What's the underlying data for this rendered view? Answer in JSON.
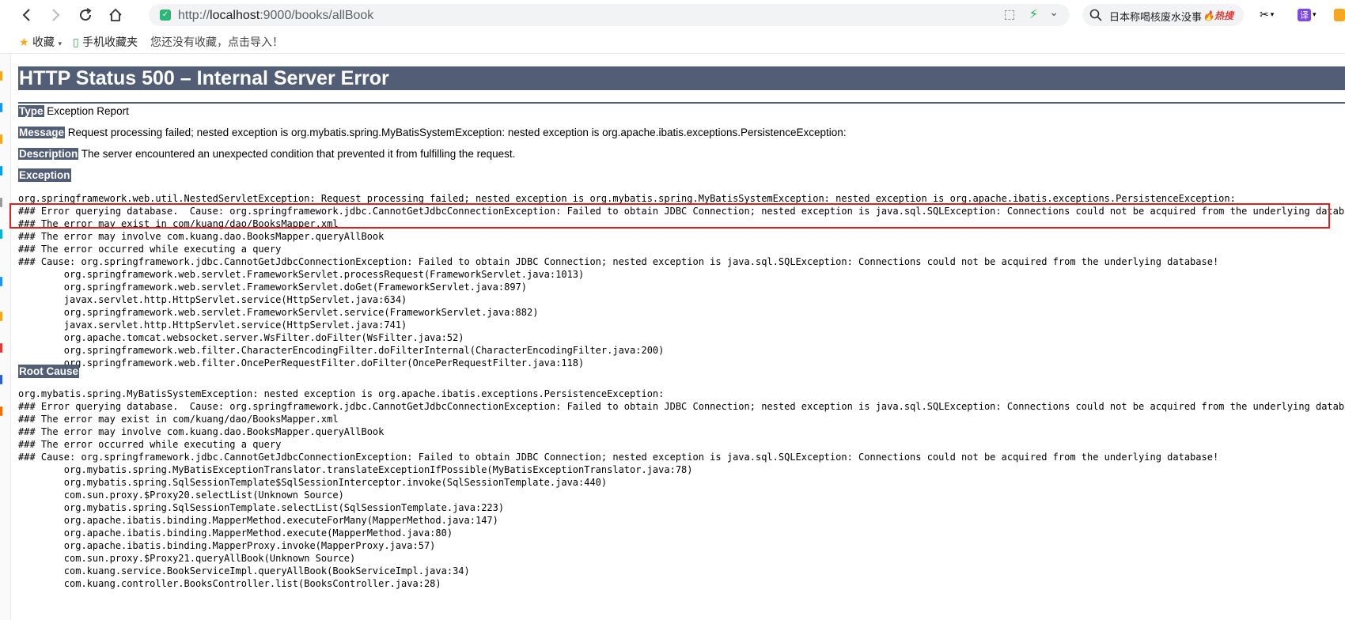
{
  "browser": {
    "url_scheme": "http://",
    "url_host": "localhost",
    "url_rest": ":9000/books/allBook",
    "search_query": "日本称喝核废水没事",
    "search_hot": "🔥热搜",
    "bookmarks": {
      "favorites": "收藏",
      "mobile": "手机收藏夹",
      "empty_hint": "您还没有收藏，点击导入！"
    },
    "translate_label": "译"
  },
  "page": {
    "title": "HTTP Status 500 – Internal Server Error",
    "type_label": "Type",
    "type_value": " Exception Report",
    "message_label": "Message",
    "message_value": " Request processing failed; nested exception is org.mybatis.spring.MyBatisSystemException: nested exception is org.apache.ibatis.exceptions.PersistenceException:",
    "description_label": "Description",
    "description_value": " The server encountered an unexpected condition that prevented it from fulfilling the request.",
    "exception_label": "Exception",
    "exception_trace": "org.springframework.web.util.NestedServletException: Request processing failed; nested exception is org.mybatis.spring.MyBatisSystemException: nested exception is org.apache.ibatis.exceptions.PersistenceException: \n### Error querying database.  Cause: org.springframework.jdbc.CannotGetJdbcConnectionException: Failed to obtain JDBC Connection; nested exception is java.sql.SQLException: Connections could not be acquired from the underlying database!\n### The error may exist in com/kuang/dao/BooksMapper.xml\n### The error may involve com.kuang.dao.BooksMapper.queryAllBook\n### The error occurred while executing a query\n### Cause: org.springframework.jdbc.CannotGetJdbcConnectionException: Failed to obtain JDBC Connection; nested exception is java.sql.SQLException: Connections could not be acquired from the underlying database!\n\torg.springframework.web.servlet.FrameworkServlet.processRequest(FrameworkServlet.java:1013)\n\torg.springframework.web.servlet.FrameworkServlet.doGet(FrameworkServlet.java:897)\n\tjavax.servlet.http.HttpServlet.service(HttpServlet.java:634)\n\torg.springframework.web.servlet.FrameworkServlet.service(FrameworkServlet.java:882)\n\tjavax.servlet.http.HttpServlet.service(HttpServlet.java:741)\n\torg.apache.tomcat.websocket.server.WsFilter.doFilter(WsFilter.java:52)\n\torg.springframework.web.filter.CharacterEncodingFilter.doFilterInternal(CharacterEncodingFilter.java:200)\n\torg.springframework.web.filter.OncePerRequestFilter.doFilter(OncePerRequestFilter.java:118)",
    "root_cause_label": "Root Cause",
    "root_cause_trace": "org.mybatis.spring.MyBatisSystemException: nested exception is org.apache.ibatis.exceptions.PersistenceException: \n### Error querying database.  Cause: org.springframework.jdbc.CannotGetJdbcConnectionException: Failed to obtain JDBC Connection; nested exception is java.sql.SQLException: Connections could not be acquired from the underlying database!\n### The error may exist in com/kuang/dao/BooksMapper.xml\n### The error may involve com.kuang.dao.BooksMapper.queryAllBook\n### The error occurred while executing a query\n### Cause: org.springframework.jdbc.CannotGetJdbcConnectionException: Failed to obtain JDBC Connection; nested exception is java.sql.SQLException: Connections could not be acquired from the underlying database!\n\torg.mybatis.spring.MyBatisExceptionTranslator.translateExceptionIfPossible(MyBatisExceptionTranslator.java:78)\n\torg.mybatis.spring.SqlSessionTemplate$SqlSessionInterceptor.invoke(SqlSessionTemplate.java:440)\n\tcom.sun.proxy.$Proxy20.selectList(Unknown Source)\n\torg.mybatis.spring.SqlSessionTemplate.selectList(SqlSessionTemplate.java:223)\n\torg.apache.ibatis.binding.MapperMethod.executeForMany(MapperMethod.java:147)\n\torg.apache.ibatis.binding.MapperMethod.execute(MapperMethod.java:80)\n\torg.apache.ibatis.binding.MapperProxy.invoke(MapperProxy.java:57)\n\tcom.sun.proxy.$Proxy21.queryAllBook(Unknown Source)\n\tcom.kuang.service.BookServiceImpl.queryAllBook(BookServiceImpl.java:34)\n\tcom.kuang.controller.BooksController.list(BooksController.java:28)"
  },
  "colors": {
    "tomcat_bar": "#525d76",
    "highlight_box": "#e02020"
  }
}
